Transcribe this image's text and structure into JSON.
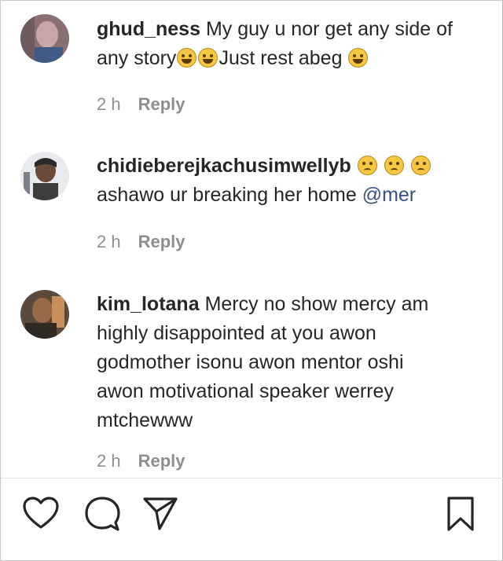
{
  "comments": [
    {
      "username": "ghud_ness",
      "line1": "My guy u nor get any side of",
      "line2_a": "any story",
      "line2_b": "Just rest abeg",
      "time": "2 h",
      "reply": "Reply"
    },
    {
      "username": "chidieberejkachusimwellyb",
      "line2": "ashawo ur breaking her home ",
      "mention": "@mer",
      "time": "2 h",
      "reply": "Reply"
    },
    {
      "username": "kim_lotana",
      "line1": "Mercy no show mercy am",
      "line2": "highly disappointed at you awon",
      "line3": "godmother isonu awon mentor oshi",
      "line4": "awon motivational speaker werrey",
      "line5": "mtchewww",
      "time": "2 h",
      "reply": "Reply"
    }
  ],
  "colors": {
    "text": "#262626",
    "meta": "#8e8e8e",
    "mention": "#385185"
  },
  "icons": [
    "heart-icon",
    "comment-icon",
    "share-icon",
    "bookmark-icon"
  ]
}
